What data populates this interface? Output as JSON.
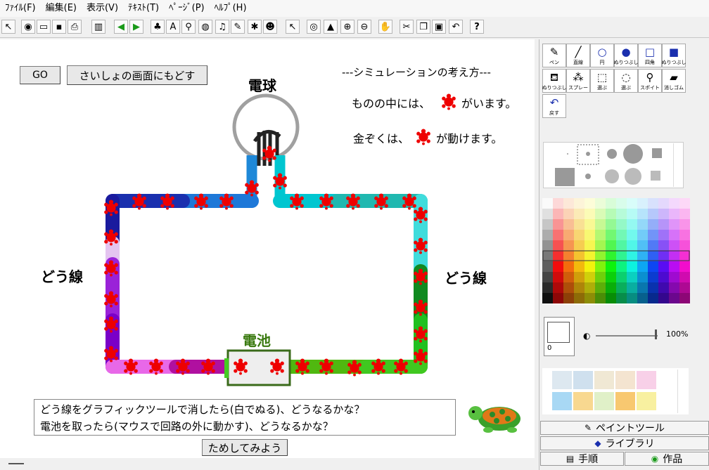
{
  "menu": [
    "ﾌｧｲﾙ(F)",
    "編集(E)",
    "表示(V)",
    "ﾃｷｽﾄ(T)",
    "ﾍﾟｰｼﾞ(P)",
    "ﾍﾙﾌﾟ(H)"
  ],
  "toolbar": {
    "icons": [
      "cursor-icon",
      "globe-icon",
      "open-folder-icon",
      "save-icon",
      "print-icon",
      "layout-icon",
      "back-arrow-icon",
      "forward-arrow-icon",
      "stamp-icon",
      "text-tool-icon",
      "spray-icon",
      "eraser-icon",
      "music-icon",
      "pencil-icon",
      "movie-icon",
      "robot-icon",
      "pointer-icon",
      "eye-icon",
      "stamp2-icon",
      "zoom-in-icon",
      "zoom-out-icon",
      "stop-hand-icon",
      "cut-icon",
      "copy-icon",
      "paste-icon",
      "undo-icon",
      "help-icon"
    ],
    "help_label": "?"
  },
  "canvas": {
    "go_label": "GO",
    "restart_label": "さいしょの画面にもどす",
    "title_line": "---シミュレーションの考え方---",
    "line1_pre": "ものの中には、",
    "line1_post": "がいます。",
    "line2_pre": "金ぞくは、",
    "line2_post": "が動けます。",
    "bulb_label": "電球",
    "wire_left_label": "どう線",
    "wire_right_label": "どう線",
    "battery_label": "電池",
    "instruction_line1": "どう線をグラフィックツールで消したら(白でぬる)、どうなるかな？",
    "instruction_line2": "電池を取ったら(マウスで回路の外に動かす)、どうなるかな？",
    "try_label": "ためしてみよう"
  },
  "panel": {
    "tools": [
      "ペン",
      "直線",
      "円",
      "ぬりつぶし",
      "四角",
      "ぬりつぶし",
      "ぬりつぶし",
      "スプレー",
      "選ぶ",
      "選ぶ",
      "スポイト",
      "消しゴム",
      "戻す"
    ],
    "opacity_value": "0",
    "percent": "100%",
    "tabs": {
      "paint": "ペイントツール",
      "library": "ライブラリ",
      "steps": "手順",
      "works": "作品"
    }
  },
  "colors": {
    "electron": "#ee0000",
    "bulb": "#a0a0a0",
    "battery_border": "#3a6a1a",
    "battery_label": "#3a7a10"
  }
}
